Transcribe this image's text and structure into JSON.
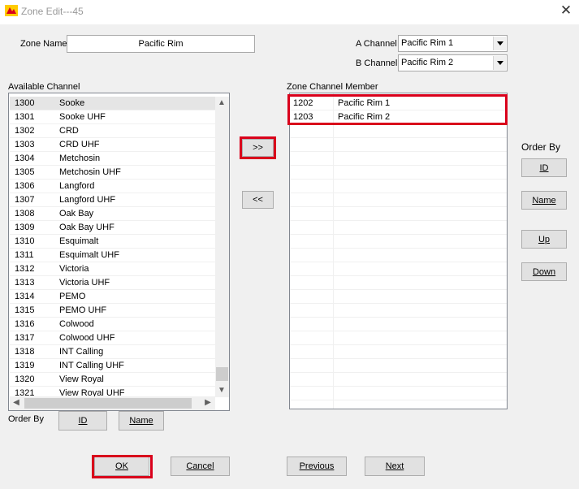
{
  "window": {
    "title": "Zone Edit---45"
  },
  "zone_name": {
    "label": "Zone Name",
    "value": "Pacific Rim"
  },
  "a_channel": {
    "label": "A Channel",
    "value": "Pacific Rim 1"
  },
  "b_channel": {
    "label": "B Channel",
    "value": "Pacific Rim 2"
  },
  "available": {
    "label": "Available Channel",
    "rows": [
      {
        "id": "1300",
        "name": "Sooke"
      },
      {
        "id": "1301",
        "name": "Sooke UHF"
      },
      {
        "id": "1302",
        "name": "CRD"
      },
      {
        "id": "1303",
        "name": "CRD UHF"
      },
      {
        "id": "1304",
        "name": "Metchosin"
      },
      {
        "id": "1305",
        "name": "Metchosin UHF"
      },
      {
        "id": "1306",
        "name": "Langford"
      },
      {
        "id": "1307",
        "name": "Langford UHF"
      },
      {
        "id": "1308",
        "name": "Oak Bay"
      },
      {
        "id": "1309",
        "name": "Oak Bay UHF"
      },
      {
        "id": "1310",
        "name": "Esquimalt"
      },
      {
        "id": "1311",
        "name": "Esquimalt UHF"
      },
      {
        "id": "1312",
        "name": "Victoria"
      },
      {
        "id": "1313",
        "name": "Victoria UHF"
      },
      {
        "id": "1314",
        "name": "PEMO"
      },
      {
        "id": "1315",
        "name": "PEMO UHF"
      },
      {
        "id": "1316",
        "name": "Colwood"
      },
      {
        "id": "1317",
        "name": "Colwood UHF"
      },
      {
        "id": "1318",
        "name": "INT Calling"
      },
      {
        "id": "1319",
        "name": "INT Calling UHF"
      },
      {
        "id": "1320",
        "name": "View Royal"
      },
      {
        "id": "1321",
        "name": "View Royal UHF"
      }
    ]
  },
  "order_by_bottom": {
    "label": "Order By",
    "id_button": "ID",
    "name_button": "Name"
  },
  "transfer": {
    "add": ">>",
    "remove": "<<"
  },
  "members": {
    "label": "Zone Channel Member",
    "rows": [
      {
        "id": "1202",
        "name": "Pacific Rim 1"
      },
      {
        "id": "1203",
        "name": "Pacific Rim 2"
      }
    ]
  },
  "order_by_side": {
    "label": "Order By",
    "id_button": "ID",
    "name_button": "Name",
    "up_button": "Up",
    "down_button": "Down"
  },
  "footer": {
    "ok": "OK",
    "cancel": "Cancel",
    "previous": "Previous",
    "next": "Next"
  },
  "colors": {
    "highlight": "#d9001b",
    "button_face": "#e1e1e1",
    "window_bg": "#f0f0f0"
  }
}
